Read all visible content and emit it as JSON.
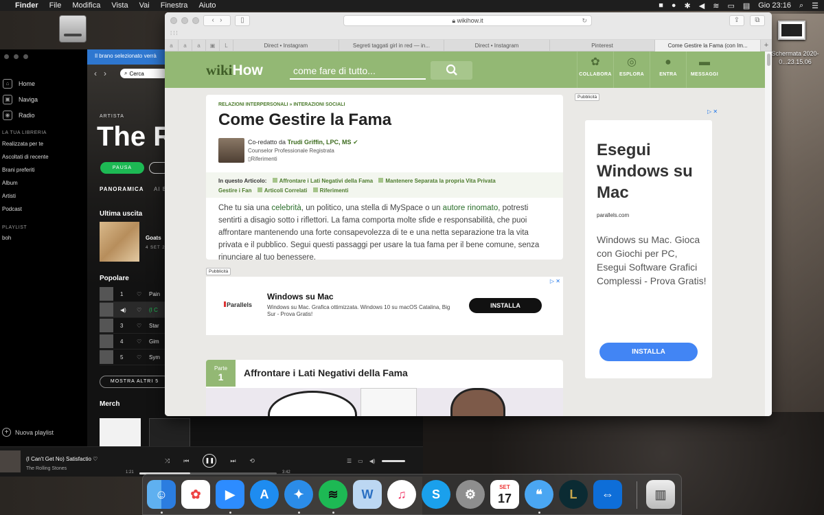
{
  "menubar": {
    "apple": "",
    "items": [
      "Finder",
      "File",
      "Modifica",
      "Vista",
      "Vai",
      "Finestra",
      "Aiuto"
    ],
    "clock": "Gio 23:16"
  },
  "desktop": {
    "screenshot_label": "Schermata 2020-0...23.15.06"
  },
  "spotify": {
    "banner": "Il brano selezionato verrà",
    "search": "Cerca",
    "nav": [
      "Home",
      "Naviga",
      "Radio"
    ],
    "library_heading": "LA TUA LIBRERIA",
    "library": [
      "Realizzata per te",
      "Ascoltati di recente",
      "Brani preferiti",
      "Album",
      "Artisti",
      "Podcast"
    ],
    "playlist_heading": "PLAYLIST",
    "playlist": "boh",
    "new_playlist": "Nuova playlist",
    "artist_label": "ARTISTA",
    "artist_name": "The R",
    "pause": "PAUSA",
    "tab_overview": "PANORAMICA",
    "tab_other": "AI B",
    "latest_release_heading": "Ultima uscita",
    "latest_release_title": "Goats",
    "latest_release_date": "4 SET 2",
    "popular_heading": "Popolare",
    "tracks": [
      {
        "num": "1",
        "name": "Pain"
      },
      {
        "num": "",
        "name": "(I C"
      },
      {
        "num": "3",
        "name": "Star"
      },
      {
        "num": "4",
        "name": "Gim"
      },
      {
        "num": "5",
        "name": "Sym"
      }
    ],
    "show_more": "MOSTRA ALTRI 5",
    "merch_heading": "Merch"
  },
  "player": {
    "title": "(I Can't Get No) Satisfactio",
    "artist": "The Rolling Stones",
    "elapsed": "1:21",
    "duration": "3:42",
    "progress": 0.37
  },
  "safari": {
    "url": "wikihow.it",
    "favorites": "a a a",
    "tabs": [
      "Direct • Instagram",
      "Segreti taggati girl in red — in...",
      "Direct • Instagram",
      "Pinterest",
      "Come Gestire la Fama (con Im..."
    ]
  },
  "wikihow": {
    "logo_wiki": "wiki",
    "logo_how": "How",
    "search_placeholder": "come fare di tutto...",
    "nav": [
      "COLLABORA",
      "ESPLORA",
      "ENTRA",
      "MESSAGGI"
    ],
    "breadcrumbs": [
      "RELAZIONI INTERPERSONALI",
      "»",
      "INTERAZIONI SOCIALI"
    ],
    "title": "Come Gestire la Fama",
    "coauthor_prefix": "Co-redatto da",
    "coauthor_name": "Trudi Griffin, LPC, MS",
    "coauthor_role": "Counselor Professionale Registrata",
    "references": "Riferimenti",
    "toc_label": "In questo Articolo:",
    "toc_items": [
      "Affrontare i Lati Negativi della Fama",
      "Mantenere Separata la propria Vita Privata",
      "Gestire i Fan",
      "Articoli Correlati",
      "Riferimenti"
    ],
    "intro_1": "Che tu sia una ",
    "intro_link1": "celebrità",
    "intro_2": ", un politico, una stella di MySpace o un ",
    "intro_link2": "autore rinomato",
    "intro_3": ", potresti sentirti a disagio sotto i riflettori. La fama comporta molte sfide e responsabilità, che puoi affrontare mantenendo una forte consapevolezza di te e una netta separazione tra la vita privata e il pubblico. Segui questi passaggi per usare la tua fama per il bene comune, senza rinunciare al tuo benessere.",
    "ad_tag": "Pubblicità",
    "inline_ad": {
      "brand": "Parallels",
      "title": "Windows su Mac",
      "desc": "Windows su Mac. Grafica ottimizzata. Windows 10 su macOS Catalina, Big Sur - Prova Gratis!",
      "button": "INSTALLA"
    },
    "part_label": "Parte",
    "part_number": "1",
    "part_title": "Affrontare i Lati Negativi della Fama",
    "side_ad": {
      "title": "Esegui Windows su Mac",
      "url": "parallels.com",
      "desc": "Windows su Mac. Gioca con Giochi per PC, Esegui Software Grafici Complessi - Prova Gratis!",
      "button": "INSTALLA"
    }
  },
  "dock": {
    "apps": [
      "finder-icon",
      "photos-icon",
      "zoom-icon",
      "app-store-icon",
      "safari-icon",
      "spotify-icon",
      "wunderbucket-icon",
      "music-icon",
      "skype-icon",
      "system-preferences-icon",
      "calendar-icon",
      "messages-icon",
      "league-of-legends-icon",
      "teamviewer-icon",
      "trash-icon"
    ],
    "calendar_month": "SET",
    "calendar_day": "17"
  }
}
